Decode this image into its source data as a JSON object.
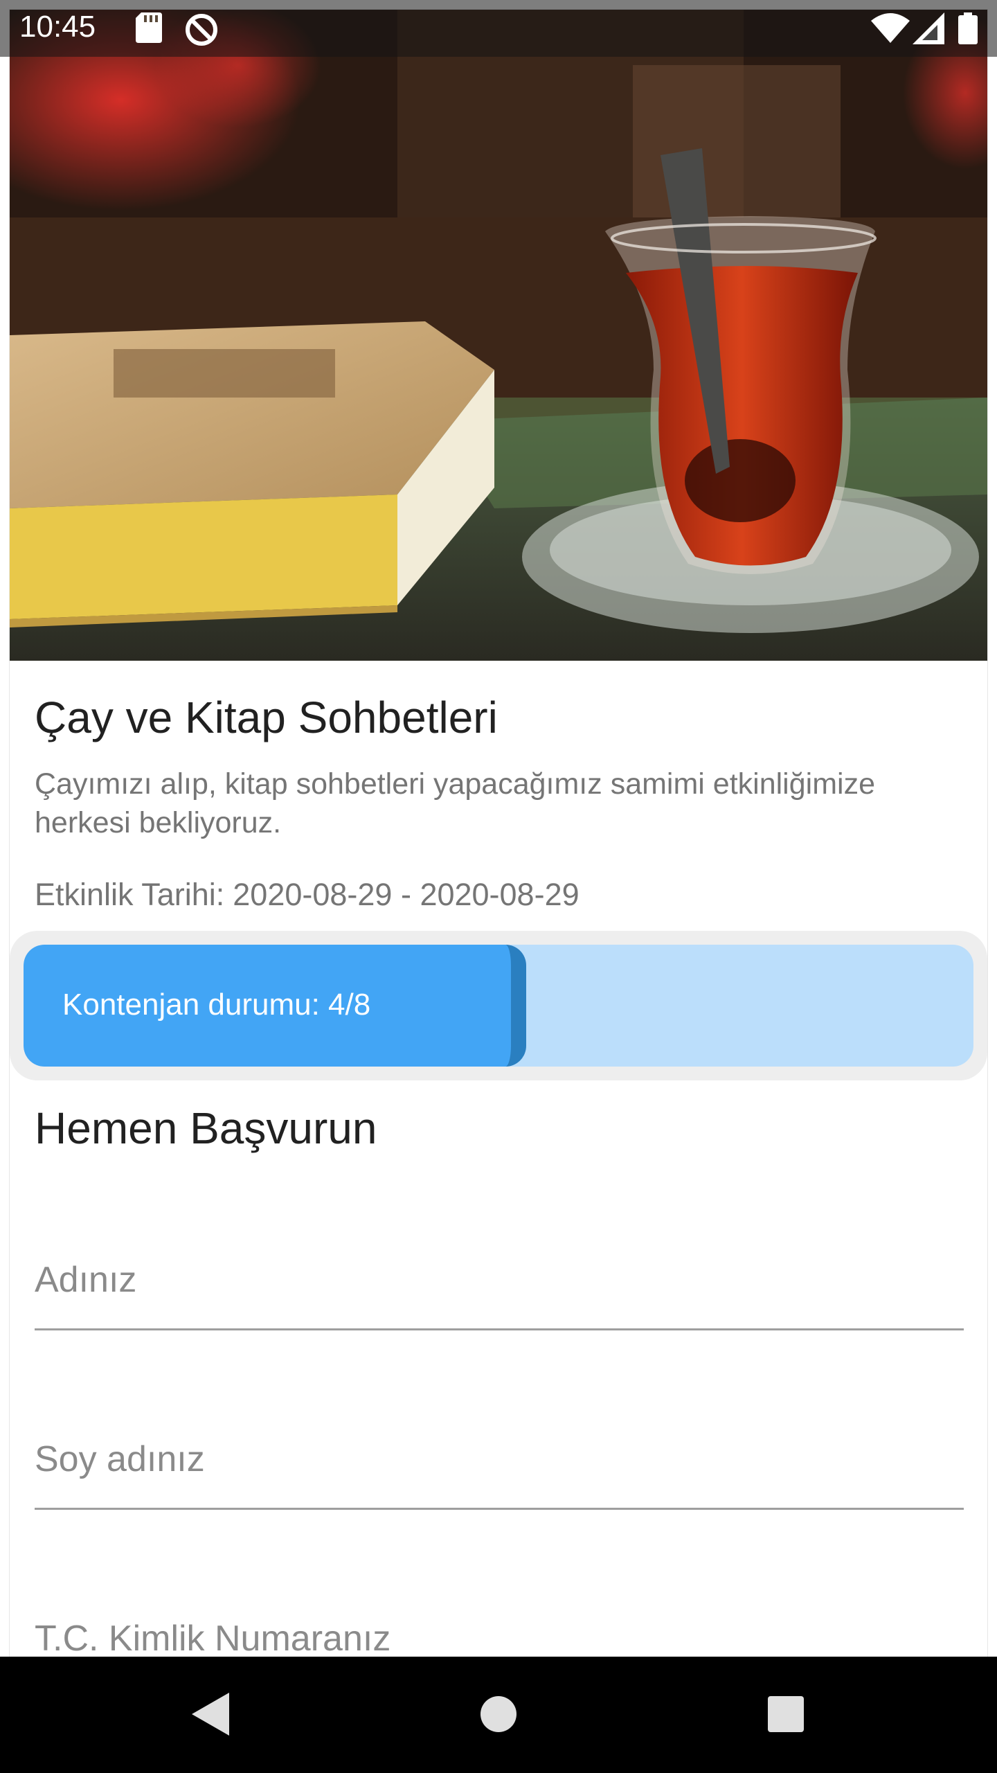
{
  "status_bar": {
    "time": "10:45",
    "icons": [
      "sd-card-icon",
      "sync-disabled-icon",
      "wifi-icon",
      "signal-icon",
      "battery-icon"
    ]
  },
  "event": {
    "title": "Çay ve Kitap Sohbetleri",
    "description": "Çayımızı alıp, kitap sohbetleri yapacağımız samimi etkinliğimize herkesi bekliyoruz.",
    "date_label": "Etkinlik Tarihi:",
    "date_value": "2020-08-29 - 2020-08-29"
  },
  "quota": {
    "label": "Kontenjan durumu: 4/8",
    "filled": 4,
    "total": 8,
    "colors": {
      "fill": "#42a5f5",
      "fill_edge": "#2a7fc0",
      "track": "#bbdefb",
      "card": "#eeeeee"
    }
  },
  "form": {
    "title": "Hemen Başvurun",
    "fields": [
      {
        "placeholder": "Adınız",
        "value": ""
      },
      {
        "placeholder": "Soy adınız",
        "value": ""
      },
      {
        "placeholder": "T.C. Kimlik Numaranız",
        "value": ""
      }
    ]
  },
  "nav": {
    "buttons": [
      "back-icon",
      "home-icon",
      "recents-icon"
    ]
  }
}
